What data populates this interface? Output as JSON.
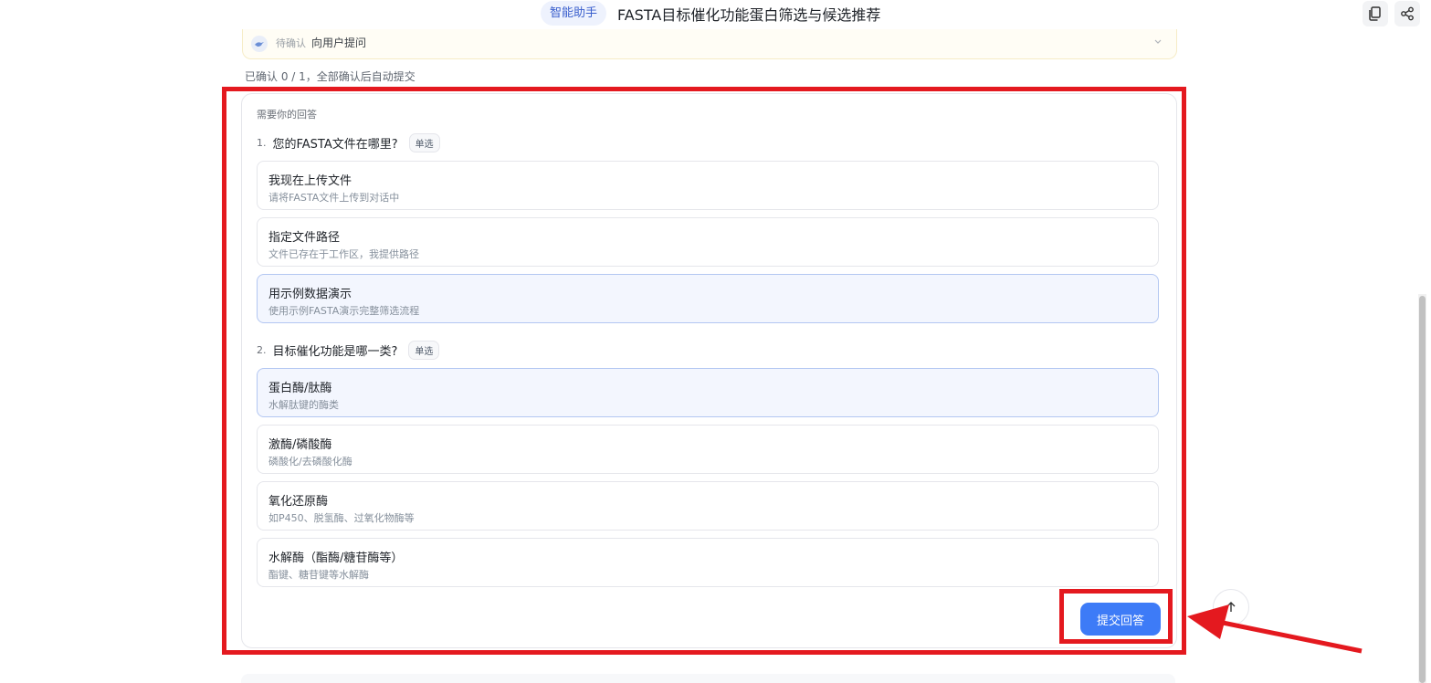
{
  "header": {
    "badge": "智能助手",
    "title": "FASTA目标催化功能蛋白筛选与候选推荐"
  },
  "pending": {
    "status": "待确认",
    "label": "向用户提问"
  },
  "confirm_status": "已确认 0 / 1，全部确认后自动提交",
  "card": {
    "heading": "需要你的回答",
    "questions": [
      {
        "num": "1.",
        "text": "您的FASTA文件在哪里?",
        "tag": "单选",
        "options": [
          {
            "title": "我现在上传文件",
            "desc": "请将FASTA文件上传到对话中",
            "selected": false
          },
          {
            "title": "指定文件路径",
            "desc": "文件已存在于工作区，我提供路径",
            "selected": false
          },
          {
            "title": "用示例数据演示",
            "desc": "使用示例FASTA演示完整筛选流程",
            "selected": true
          }
        ]
      },
      {
        "num": "2.",
        "text": "目标催化功能是哪一类?",
        "tag": "单选",
        "options": [
          {
            "title": "蛋白酶/肽酶",
            "desc": "水解肽键的酶类",
            "selected": true
          },
          {
            "title": "激酶/磷酸酶",
            "desc": "磷酸化/去磷酸化酶",
            "selected": false
          },
          {
            "title": "氧化还原酶",
            "desc": "如P450、脱氢酶、过氧化物酶等",
            "selected": false
          },
          {
            "title": "水解酶（酯酶/糖苷酶等）",
            "desc": "酯键、糖苷键等水解酶",
            "selected": false
          }
        ]
      }
    ],
    "submit_label": "提交回答"
  },
  "colors": {
    "accent": "#3d7bf7",
    "selected_bg": "#f3f6fe",
    "annotation_red": "#e4191f"
  }
}
